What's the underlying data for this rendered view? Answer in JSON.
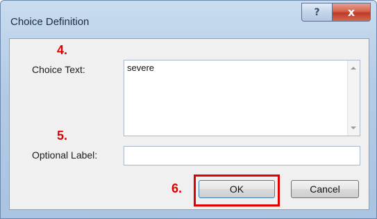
{
  "window": {
    "title": "Choice Definition",
    "help_glyph": "?",
    "close_glyph": "x"
  },
  "annotations": {
    "step4": "4.",
    "step5": "5.",
    "step6": "6."
  },
  "form": {
    "choice_text_label": "Choice Text:",
    "choice_text_value": "severe",
    "optional_label_label": "Optional Label:",
    "optional_label_value": ""
  },
  "buttons": {
    "ok": "OK",
    "cancel": "Cancel"
  },
  "colors": {
    "annotation_red": "#e00000",
    "title_bar": "#b3cbe6",
    "close_button": "#c0392b"
  }
}
